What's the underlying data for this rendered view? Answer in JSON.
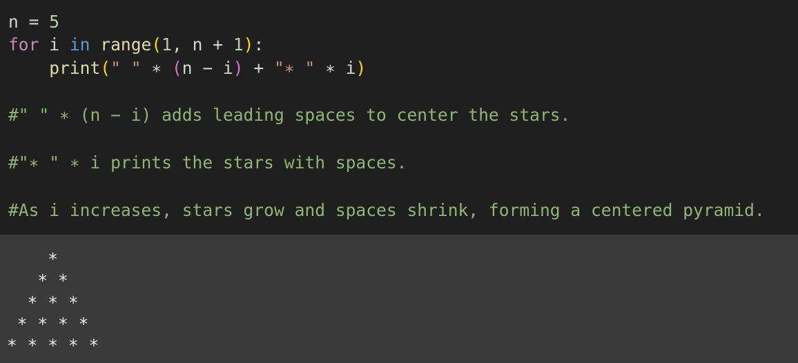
{
  "editor": {
    "line1": {
      "var": "n",
      "op": " = ",
      "num": "5"
    },
    "line2": {
      "kw_for": "for",
      "sp1": " ",
      "var_i": "i",
      "sp2": " ",
      "kw_in": "in",
      "sp3": " ",
      "fn_range": "range",
      "lparen": "(",
      "num1": "1",
      "mid": ", n + ",
      "num2": "1",
      "rparen": ")",
      "colon": ":"
    },
    "line3": {
      "indent": "    ",
      "fn_print": "print",
      "lparen": "(",
      "str1": "\" \"",
      "op1": " ∗ ",
      "lparen2": "(",
      "expr": "n − i",
      "rparen2": ")",
      "op2": " + ",
      "str2": "\"∗ \"",
      "op3": " ∗ i",
      "rparen": ")"
    },
    "comments": [
      "#\" \" ∗ (n − i) adds leading spaces to center the stars.",
      "#\"∗ \" ∗ i prints the stars with spaces.",
      "#As i increases, stars grow and spaces shrink, forming a centered pyramid."
    ]
  },
  "output": {
    "lines": [
      "    ∗",
      "   ∗ ∗",
      "  ∗ ∗ ∗",
      " ∗ ∗ ∗ ∗",
      "∗ ∗ ∗ ∗ ∗"
    ]
  },
  "colors": {
    "editor_bg": "#1f1f1f",
    "output_bg": "#3a3a3a",
    "keyword": "#c586c0",
    "keyword_in": "#569cd6",
    "function": "#dcdcaa",
    "number": "#b5cea8",
    "string": "#ce9178",
    "comment": "#8fb573"
  }
}
